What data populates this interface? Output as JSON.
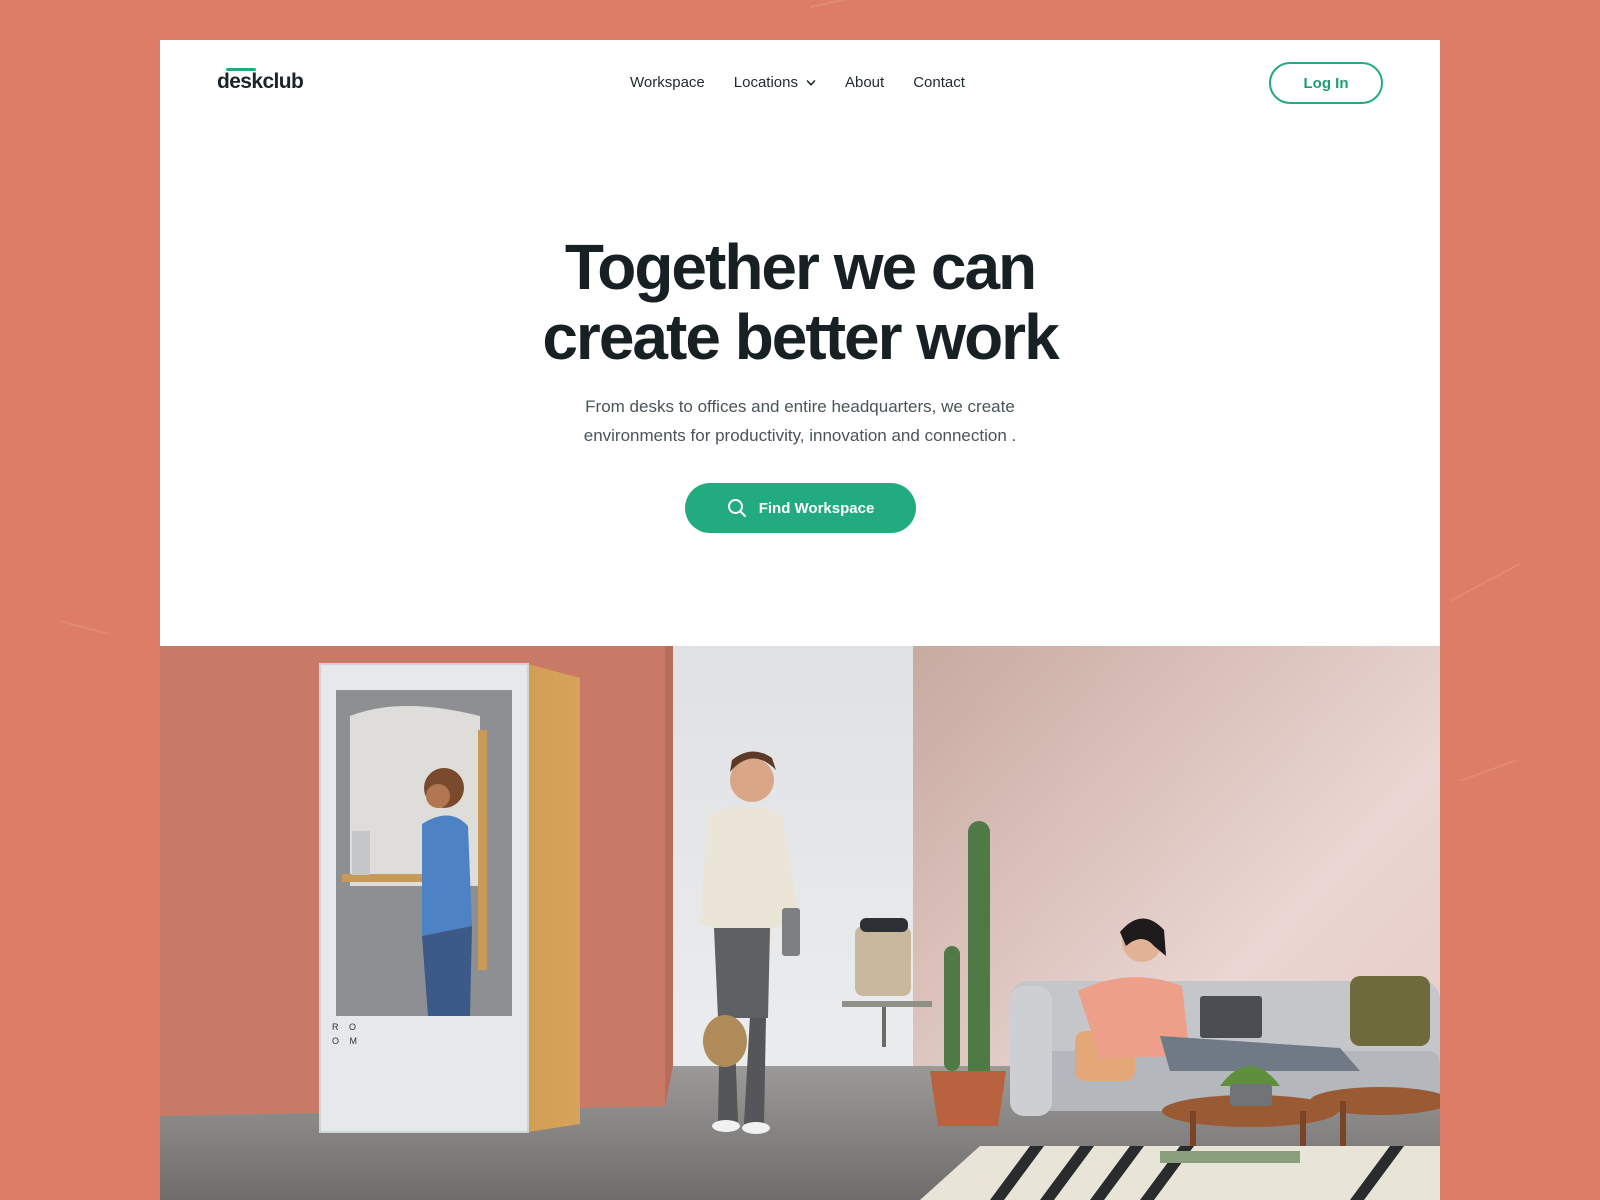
{
  "logo": {
    "text": "deskclub"
  },
  "nav": {
    "items": [
      {
        "label": "Workspace"
      },
      {
        "label": "Locations",
        "has_dropdown": true
      },
      {
        "label": "About"
      },
      {
        "label": "Contact"
      }
    ],
    "login_label": "Log In"
  },
  "hero": {
    "title_line1": "Together we can",
    "title_line2": "create better work",
    "subtitle_line1": "From desks to offices and entire headquarters, we create",
    "subtitle_line2": "environments for productivity, innovation and connection .",
    "cta_label": "Find Workspace",
    "cta_icon": "search-icon"
  },
  "photo": {
    "booth_text_line1": "R O",
    "booth_text_line2": "O M"
  },
  "colors": {
    "background": "#dd7d67",
    "accent": "#21ab7e",
    "text_dark": "#172023"
  }
}
